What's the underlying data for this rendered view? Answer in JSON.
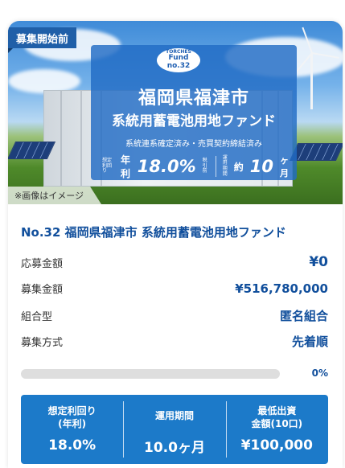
{
  "hero": {
    "status_badge": "募集開始前",
    "caption": "※画像はイメージ",
    "logo": {
      "line1": "TORCHES",
      "line2": "Fund no.32"
    },
    "title_line1": "福岡県福津市",
    "title_line2": "系統用蓄電池用地ファンド",
    "subtitle": "系統連系確定済み・売買契約締結済み",
    "yield_small": "想定利回り",
    "yield_label": "年 利",
    "yield_value": "18.0%",
    "yield_tax": "税引前",
    "period_small1": "運用",
    "period_small2": "期間",
    "period_prefix": "約",
    "period_value": "10",
    "period_unit": "ヶ月"
  },
  "fund": {
    "title": "No.32 福岡県福津市 系統用蓄電池用地ファンド"
  },
  "details": [
    {
      "label": "応募金額",
      "value": "¥0"
    },
    {
      "label": "募集金額",
      "value": "¥516,780,000"
    },
    {
      "label": "組合型",
      "value": "匿名組合"
    },
    {
      "label": "募集方式",
      "value": "先着順"
    }
  ],
  "progress": {
    "percent_text": "0%",
    "fraction": 0.0
  },
  "stats": [
    {
      "head": "想定利回り\n(年利)",
      "value": "18.0%"
    },
    {
      "head": "運用期間",
      "value": "10.0ヶ月"
    },
    {
      "head": "最低出資\n金額(10口)",
      "value": "¥100,000"
    }
  ],
  "colors": {
    "accent": "#114f9c",
    "panel": "#1c7ac9",
    "badge": "#1f5fa8"
  }
}
